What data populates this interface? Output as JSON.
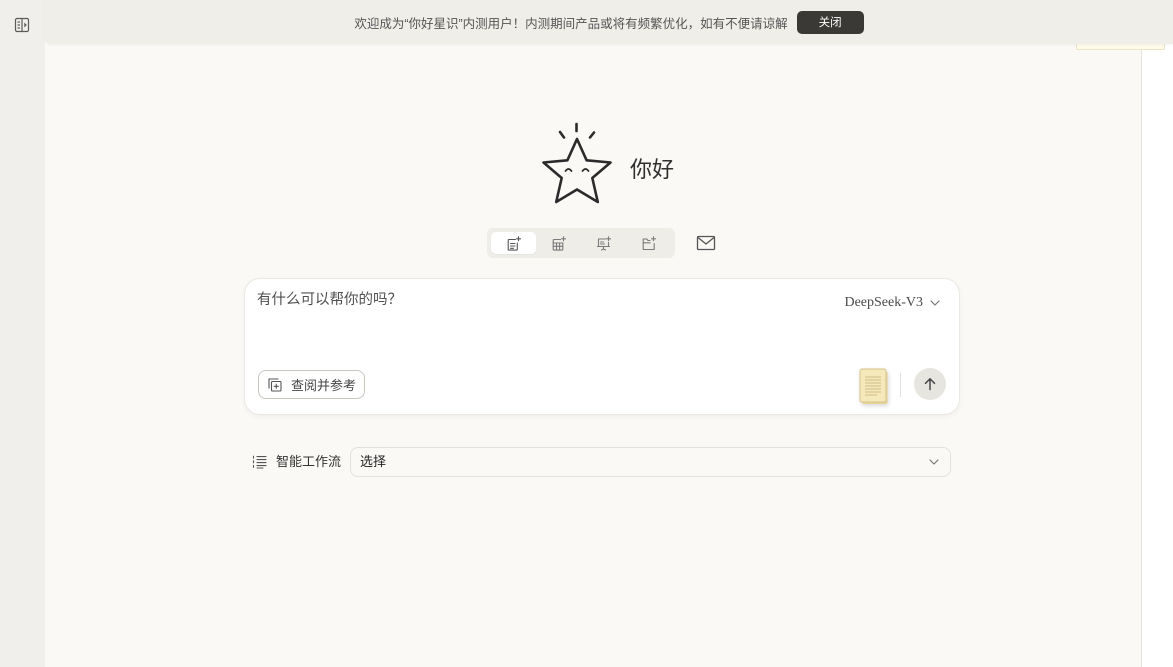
{
  "sidebar": {
    "toggle_icon": "sidebar-expand-icon"
  },
  "banner": {
    "message": "欢迎成为“你好星识”内测用户！内测期间产品或将有频繁优化，如有不便请谅解",
    "close_label": "关闭"
  },
  "hero": {
    "mascot_icon": "star-mascot-icon",
    "greeting": "你好"
  },
  "toolbar": {
    "tabs": [
      {
        "icon": "new-document-icon",
        "selected": true
      },
      {
        "icon": "new-table-icon",
        "selected": false
      },
      {
        "icon": "new-slides-icon",
        "selected": false
      },
      {
        "icon": "new-folder-icon",
        "selected": false
      }
    ],
    "mail_icon": "mail-icon"
  },
  "composer": {
    "placeholder": "有什么可以帮你的吗？",
    "model": "DeepSeek-V3",
    "model_icon": "chevron-down-icon",
    "reference_label": "查阅并参考",
    "reference_icon": "add-reference-icon",
    "notes_icon": "notepad-icon",
    "send_icon": "arrow-up-icon"
  },
  "workflow": {
    "icon": "workflow-list-icon",
    "label": "智能工作流",
    "selected": "选择"
  },
  "colors": {
    "page_background": "#faf9f6",
    "sidebar_background": "#f1efeb",
    "banner_background": "#f0eee9",
    "close_button": "#3a3936",
    "notepad": "#f5e9bb"
  }
}
